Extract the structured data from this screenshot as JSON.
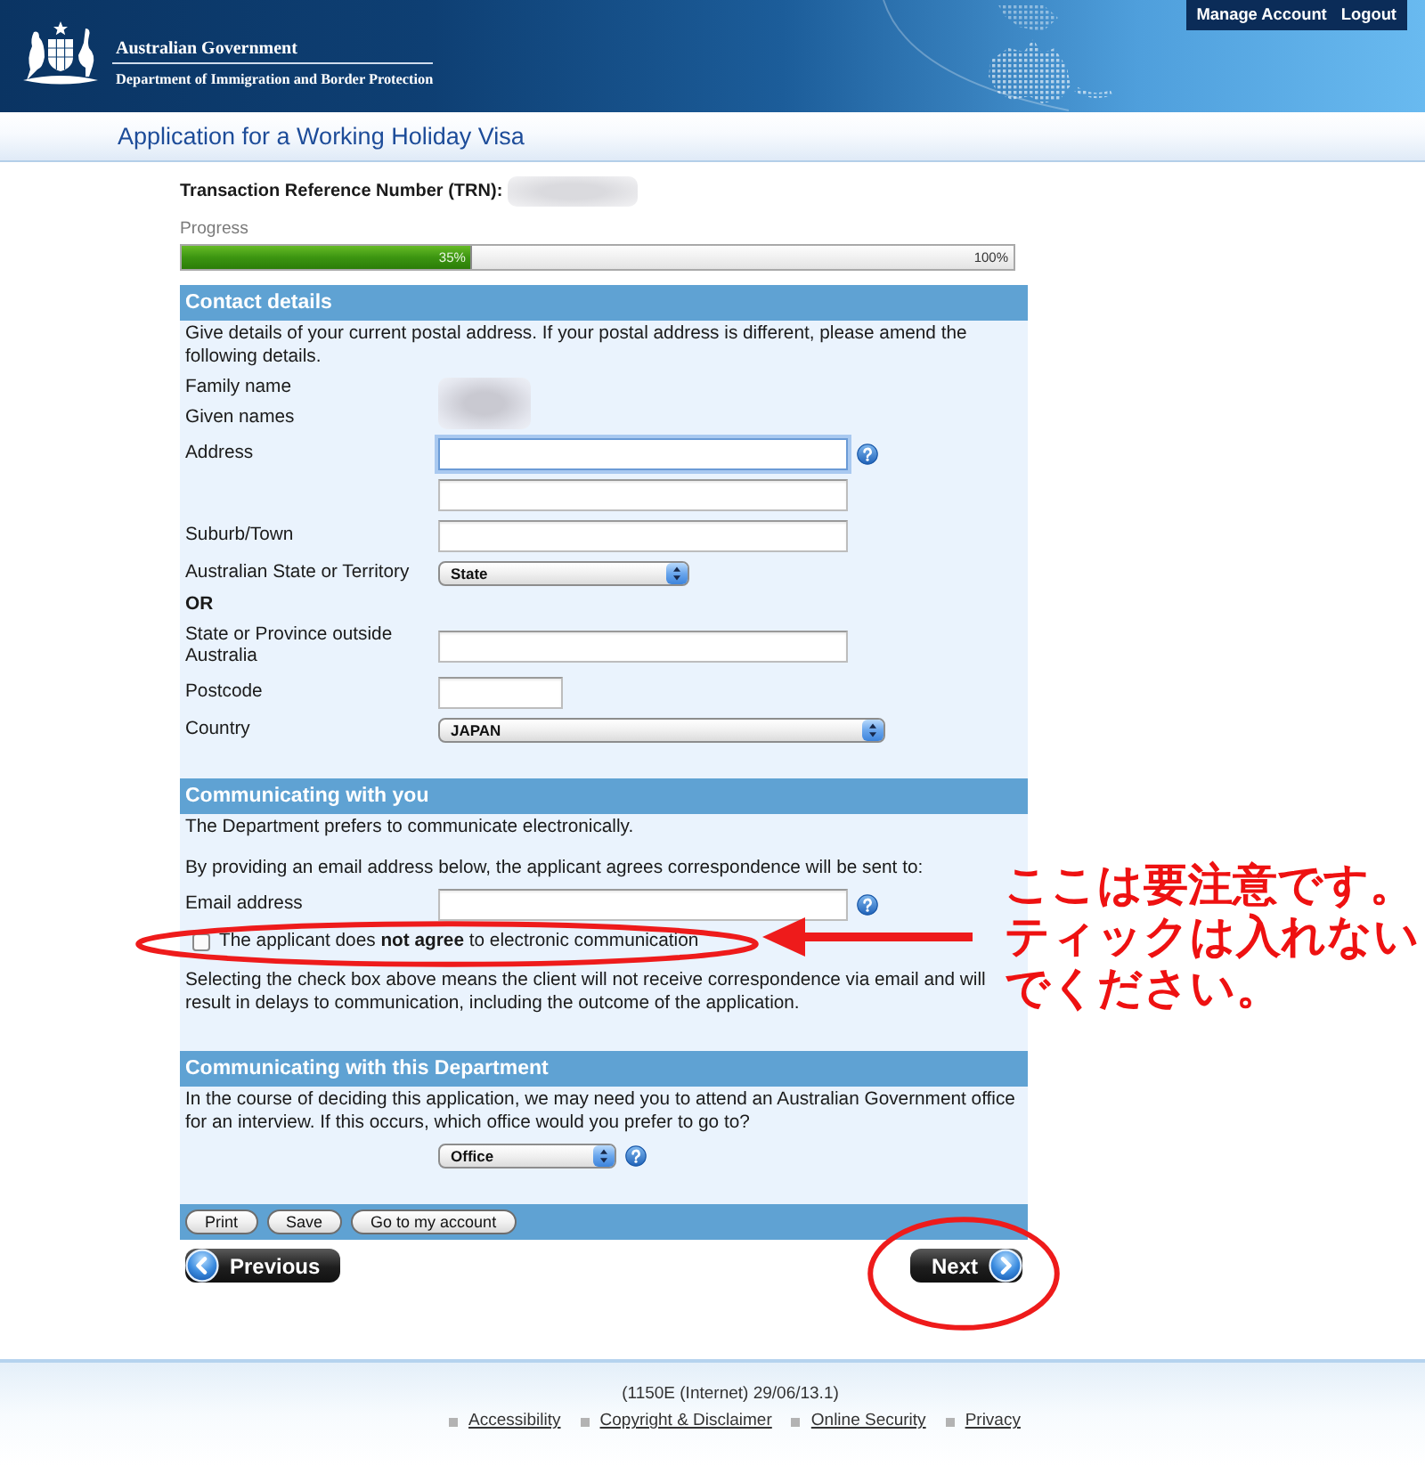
{
  "header": {
    "agency": "Australian Government",
    "department": "Department of Immigration and Border Protection",
    "account_links": [
      "Manage Account",
      "Logout"
    ]
  },
  "title": "Application for a Working Holiday Visa",
  "trn": {
    "label": "Transaction Reference Number (TRN):"
  },
  "progress": {
    "label": "Progress",
    "level": 0.35,
    "reading": "35%",
    "end_label": "100%"
  },
  "sections": [
    {
      "title": "Contact details",
      "items": [
        {
          "kind": "text",
          "text": "Give details of your current postal address. If your postal address is different, please amend the following details."
        },
        {
          "kind": "blurred",
          "labels": [
            "Family name",
            "Given names"
          ]
        },
        {
          "kind": "input",
          "label": "Address",
          "focused": true,
          "help": true
        },
        {
          "kind": "input",
          "focused": false,
          "help": false
        },
        {
          "kind": "input",
          "label": "Suburb/Town",
          "focused": false,
          "help": false
        },
        {
          "kind": "select",
          "label": "Australian State or Territory",
          "value": "State",
          "help": false
        },
        {
          "kind": "heading",
          "text": "OR"
        },
        {
          "kind": "input",
          "label": "State or Province outside Australia",
          "focused": false,
          "help": false
        },
        {
          "kind": "short_input",
          "label": "Postcode",
          "focused": false,
          "help": false
        },
        {
          "kind": "select",
          "label": "Country",
          "value": "JAPAN",
          "help": false
        }
      ]
    },
    {
      "title": "Communicating with you",
      "items": [
        {
          "kind": "text",
          "text": "The Department prefers to communicate electronically."
        },
        {
          "kind": "text",
          "text": "By providing an email address below, the applicant agrees correspondence will be sent to:"
        },
        {
          "kind": "input",
          "label": "Email address",
          "focused": false,
          "help": true
        },
        {
          "kind": "checkbox",
          "label": "The applicant does **not agree** to electronic communication",
          "checked": false
        },
        {
          "kind": "text",
          "text": "Selecting the check box above means the client will not receive correspondence via email and will result in delays to communication, including the outcome of the application."
        }
      ]
    },
    {
      "title": "Communicating with this Department",
      "items": [
        {
          "kind": "text",
          "text": "In the course of deciding this application, we may need you to attend an Australian Government office for an interview. If this occurs, which office would you prefer to go to?"
        },
        {
          "kind": "select",
          "value": "Office",
          "help": true
        }
      ]
    }
  ],
  "action_buttons": [
    "Print",
    "Save",
    "Go to my account"
  ],
  "navigation": {
    "previous": "Previous",
    "next": "Next"
  },
  "footer": {
    "version": "(1150E (Internet) 29/06/13.1)",
    "links": [
      "Accessibility",
      "Copyright & Disclaimer",
      "Online Security",
      "Privacy"
    ]
  },
  "annotation": {
    "note_lines": [
      "ここは要注意です。",
      "ティックは入れない",
      "でください。"
    ]
  }
}
